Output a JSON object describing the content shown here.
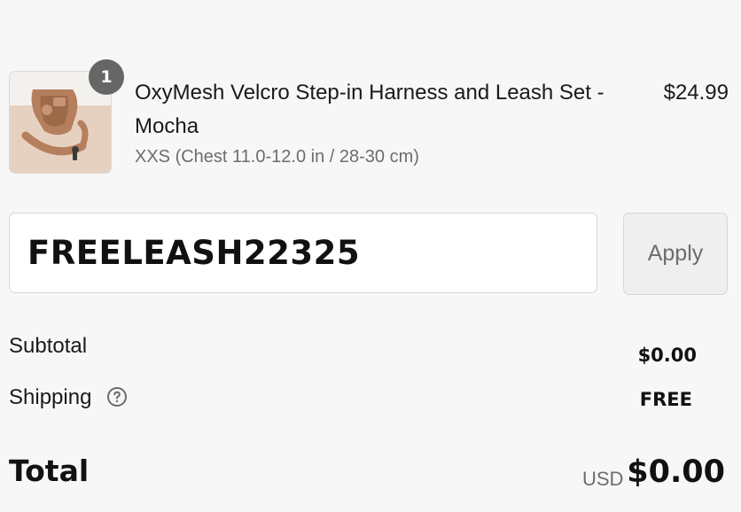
{
  "line_item": {
    "quantity": "1",
    "title": "OxyMesh Velcro Step-in Harness and Leash Set - Mocha",
    "variant": "XXS (Chest 11.0-12.0 in / 28-30 cm)",
    "price": "$24.99",
    "image_icon": "harness-leash-product-icon"
  },
  "discount": {
    "code_value": "FREELEASH22325",
    "apply_label": "Apply"
  },
  "summary": {
    "subtotal_label": "Subtotal",
    "subtotal_value": "$0.00",
    "shipping_label": "Shipping",
    "shipping_value": "FREE",
    "shipping_help_icon": "question-circle-icon",
    "total_label": "Total",
    "total_currency": "USD",
    "total_value": "$0.00"
  },
  "colors": {
    "background": "#f7f7f7",
    "badge": "#666666",
    "muted_text": "#6d6d6d",
    "product_brown": "#b57e5c"
  }
}
